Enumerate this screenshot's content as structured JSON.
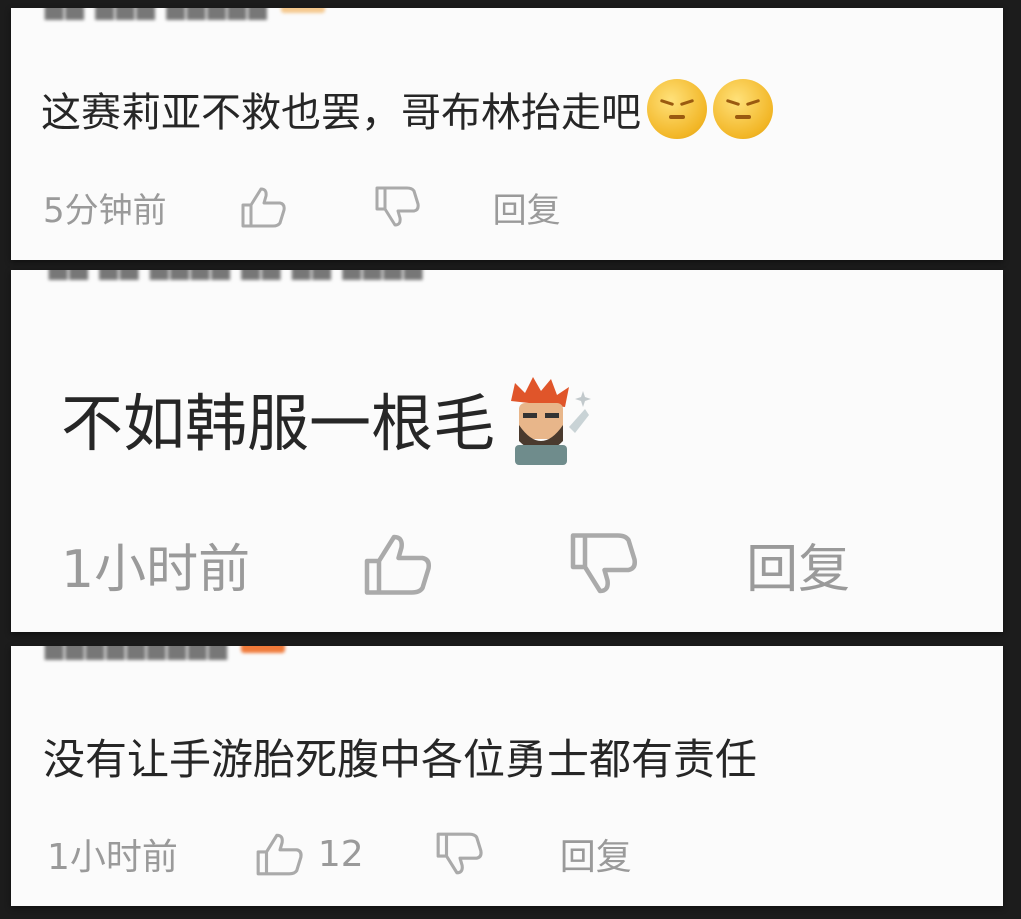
{
  "comments": [
    {
      "text": "这赛莉亚不救也罢，哥布林抬走吧",
      "emojis": [
        "smirk-face-emoji",
        "smirk-face-emoji"
      ],
      "time": "5分钟前",
      "reply_label": "回复"
    },
    {
      "text": "不如韩服一根毛",
      "sticker": "character-sticker",
      "time": "1小时前",
      "reply_label": "回复"
    },
    {
      "text": "没有让手游胎死腹中各位勇士都有责任",
      "time": "1小时前",
      "like_count": "12",
      "reply_label": "回复"
    }
  ],
  "colors": {
    "text": "#262626",
    "meta": "#9a9a9a",
    "badge": "#f07a3a",
    "emoji": "#f2b626"
  }
}
